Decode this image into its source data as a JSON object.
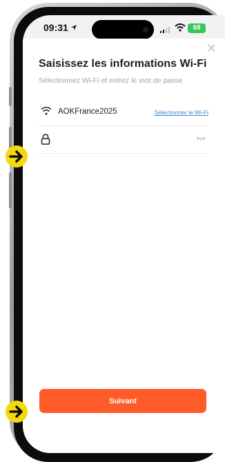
{
  "status_bar": {
    "time": "09:31",
    "battery": "69",
    "location_icon": "navigation-arrow-icon"
  },
  "dialog": {
    "close_icon": "close-icon",
    "title": "Saisissez les informations Wi-Fi",
    "subtitle": "Sélectionnez Wi-Fi et entrez le mot de passe",
    "wifi_row": {
      "icon": "wifi-icon",
      "ssid": "AOKFrance2025",
      "select_link": "Sélectionner le Wi-Fi"
    },
    "password_row": {
      "icon": "lock-icon",
      "value": "",
      "placeholder": "",
      "toggle_icon": "eye-closed-icon"
    },
    "next_button": "Suivant"
  },
  "annotations": {
    "arrow_icon": "arrow-right-circle-icon",
    "color": "#f5d90a"
  },
  "colors": {
    "accent": "#ff5c29",
    "link": "#3c83c8",
    "battery": "#34c759"
  }
}
